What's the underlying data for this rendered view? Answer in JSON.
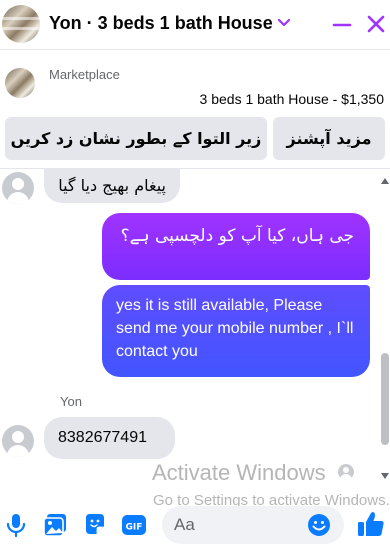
{
  "header": {
    "title": "Yon · 3 beds 1 bath House",
    "accent_color": "#a033ff"
  },
  "marketplace": {
    "label": "Marketplace",
    "listing": "3 beds 1 bath House - $1,350",
    "buttons": {
      "report": "زیر التوا کے بطور نشان زد کریں",
      "more": "مزید آپشنز"
    }
  },
  "conversation": {
    "messages": [
      {
        "direction": "incoming",
        "text": "پیغام بھیج دیا گیا"
      },
      {
        "direction": "outgoing",
        "text": "جی ہاں، کیا آپ کو دلچسپی ہے؟"
      },
      {
        "direction": "outgoing",
        "text": "yes it is still available, Please send me your mobile number , I`ll contact  you"
      },
      {
        "direction": "incoming",
        "sender": "Yon",
        "text": "8382677491"
      }
    ]
  },
  "watermark": {
    "line1": "Activate Windows",
    "line2": "Go to Settings to activate Windows."
  },
  "composer": {
    "placeholder": "Aa",
    "icons": [
      "microphone-icon",
      "photo-icon",
      "sticker-icon",
      "gif-icon",
      "emoji-icon",
      "like-icon"
    ],
    "gif_label": "GIF",
    "icon_color": "#0a7cff"
  }
}
